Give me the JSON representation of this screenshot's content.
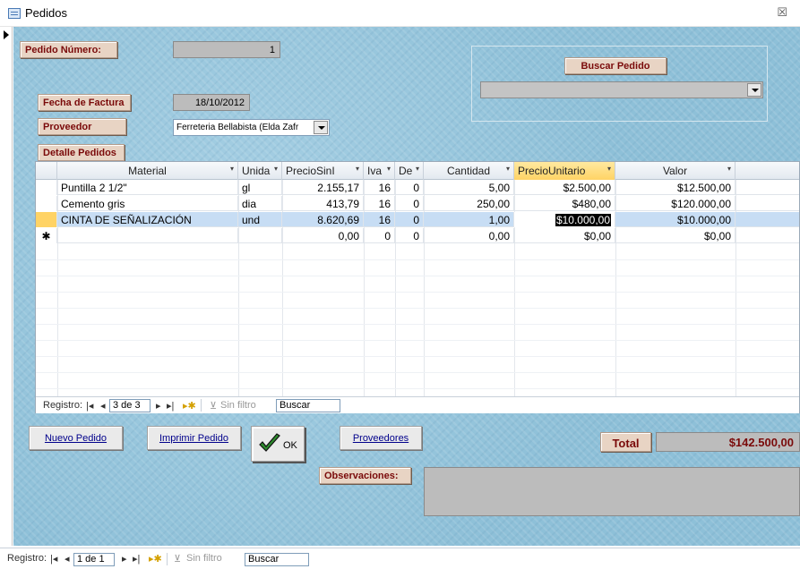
{
  "window": {
    "title": "Pedidos",
    "close_symbol": "☒"
  },
  "form": {
    "pedido_numero": {
      "label": "Pedido Número:",
      "value": "1"
    },
    "fecha_factura": {
      "label": "Fecha de Factura",
      "value": "18/10/2012"
    },
    "proveedor": {
      "label": "Proveedor",
      "value": "Ferreteria Bellabista (Elda Zafr"
    },
    "buscar_pedido": {
      "button_label": "Buscar  Pedido",
      "combo_value": ""
    },
    "detalle_label": "Detalle Pedidos"
  },
  "grid": {
    "columns": [
      {
        "label": "Material",
        "sort": "▾"
      },
      {
        "label": "Unida",
        "sort": "▾"
      },
      {
        "label": "PrecioSinI",
        "sort": "▾"
      },
      {
        "label": "Iva",
        "sort": "▾"
      },
      {
        "label": "De",
        "sort": "▾"
      },
      {
        "label": "Cantidad",
        "sort": "▾"
      },
      {
        "label": "PrecioUnitario",
        "sort": "▾"
      },
      {
        "label": "Valor",
        "sort": "▾"
      }
    ],
    "rows": [
      {
        "marker": "",
        "material": "Puntilla 2 1/2\"",
        "unidad": "gl",
        "precio_sin_iva": "2.155,17",
        "iva": "16",
        "descuento": "0",
        "cantidad": "5,00",
        "precio_unitario": "$2.500,00",
        "valor": "$12.500,00"
      },
      {
        "marker": "",
        "material": "Cemento gris",
        "unidad": "dia",
        "precio_sin_iva": "413,79",
        "iva": "16",
        "descuento": "0",
        "cantidad": "250,00",
        "precio_unitario": "$480,00",
        "valor": "$120.000,00"
      },
      {
        "marker": "",
        "material": "CINTA DE SEÑALIZACIÓN",
        "unidad": "und",
        "precio_sin_iva": "8.620,69",
        "iva": "16",
        "descuento": "0",
        "cantidad": "1,00",
        "precio_unitario": "$10.000,00",
        "valor": "$10.000,00"
      },
      {
        "marker": "✱",
        "material": "",
        "unidad": "",
        "precio_sin_iva": "0,00",
        "iva": "0",
        "descuento": "0",
        "cantidad": "0,00",
        "precio_unitario": "$0,00",
        "valor": "$0,00"
      }
    ],
    "nav": {
      "label": "Registro:",
      "position": "3 de 3",
      "filter": "Sin filtro",
      "search": "Buscar"
    }
  },
  "buttons": {
    "nuevo_pedido": "Nuevo Pedido",
    "imprimir_pedido": "Imprimir Pedido",
    "ok": "OK",
    "proveedores": "Proveedores"
  },
  "total": {
    "label": "Total",
    "value": "$142.500,00"
  },
  "observaciones": {
    "label": "Observaciones:",
    "value": ""
  },
  "form_nav": {
    "label": "Registro:",
    "position": "1 de 1",
    "filter": "Sin filtro",
    "search": "Buscar"
  },
  "colors": {
    "form_background": "#8ec0d8",
    "label_text": "#7a0a0a",
    "label_background": "#e8d4c4",
    "selected_column": "#ffd365",
    "current_row": "#c7ddf4"
  }
}
